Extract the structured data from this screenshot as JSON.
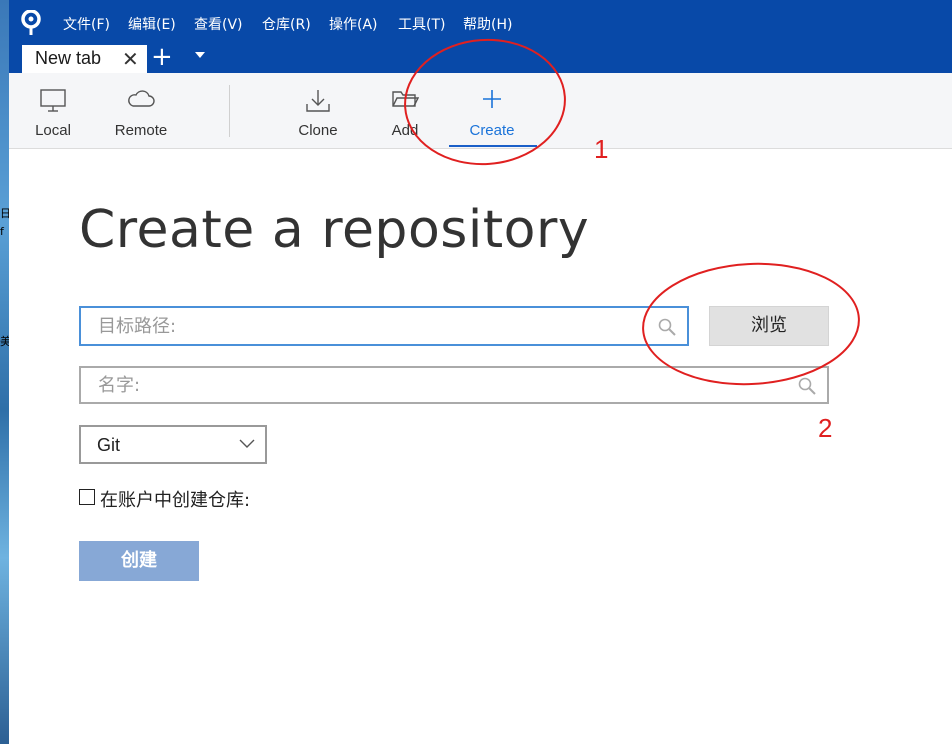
{
  "menu": {
    "items": [
      "文件(F)",
      "编辑(E)",
      "查看(V)",
      "仓库(R)",
      "操作(A)",
      "工具(T)",
      "帮助(H)"
    ]
  },
  "tabs": {
    "active_label": "New tab",
    "close_glyph": "✕",
    "add_glyph": "+"
  },
  "toolbar": {
    "local": "Local",
    "remote": "Remote",
    "clone": "Clone",
    "add": "Add",
    "create": "Create"
  },
  "page": {
    "title": "Create a repository",
    "path_placeholder": "目标路径:",
    "name_placeholder": "名字:",
    "browse_label": "浏览",
    "vcs_selected": "Git",
    "account_label": "在账户中创建仓库:",
    "create_label": "创建"
  },
  "annotations": {
    "mark_1": "1",
    "mark_2": "2"
  },
  "desktop_fragments": [
    "日",
    "f",
    "美"
  ],
  "colors": {
    "titlebar": "#0849a8",
    "accent": "#1a73d9",
    "create_button": "#87a8d6",
    "annotation": "#e02020"
  }
}
